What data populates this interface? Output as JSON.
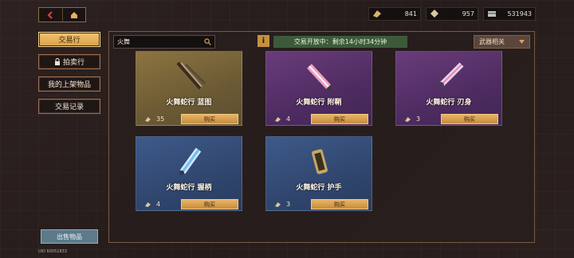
{
  "nav": {
    "back_icon": "back-arrow-icon",
    "home_icon": "home-icon"
  },
  "resources": [
    {
      "icon": "crystal-shard-icon",
      "value": "841"
    },
    {
      "icon": "gem-icon",
      "value": "957"
    },
    {
      "icon": "currency-card-icon",
      "value": "531943"
    }
  ],
  "sidebar": {
    "items": [
      {
        "label": "交易行",
        "active": true
      },
      {
        "label": "拍卖行",
        "active": false,
        "icon": "lock-icon"
      },
      {
        "label": "我的上架物品",
        "active": false
      },
      {
        "label": "交易记录",
        "active": false
      }
    ],
    "sell_label": "出售物品",
    "uid": "UID 60051833"
  },
  "toolbar": {
    "search_value": "火舞",
    "info_label": "i",
    "status_text": "交易开放中：剩余14小时34分钟",
    "filter_label": "武器相关"
  },
  "items": [
    {
      "name": "火舞蛇行 蓝图",
      "count": "35",
      "buy": "购买",
      "rarity": "gold",
      "color": "#8c7440"
    },
    {
      "name": "火舞蛇行 附鞘",
      "count": "4",
      "buy": "购买",
      "rarity": "purple",
      "color": "#6a3c7a"
    },
    {
      "name": "火舞蛇行 刃身",
      "count": "3",
      "buy": "购买",
      "rarity": "purple",
      "color": "#6a3c7a"
    },
    {
      "name": "火舞蛇行 握柄",
      "count": "4",
      "buy": "购买",
      "rarity": "blue",
      "color": "#3e5a8a"
    },
    {
      "name": "火舞蛇行 护手",
      "count": "3",
      "buy": "购买",
      "rarity": "blue",
      "color": "#3e5a8a"
    }
  ]
}
